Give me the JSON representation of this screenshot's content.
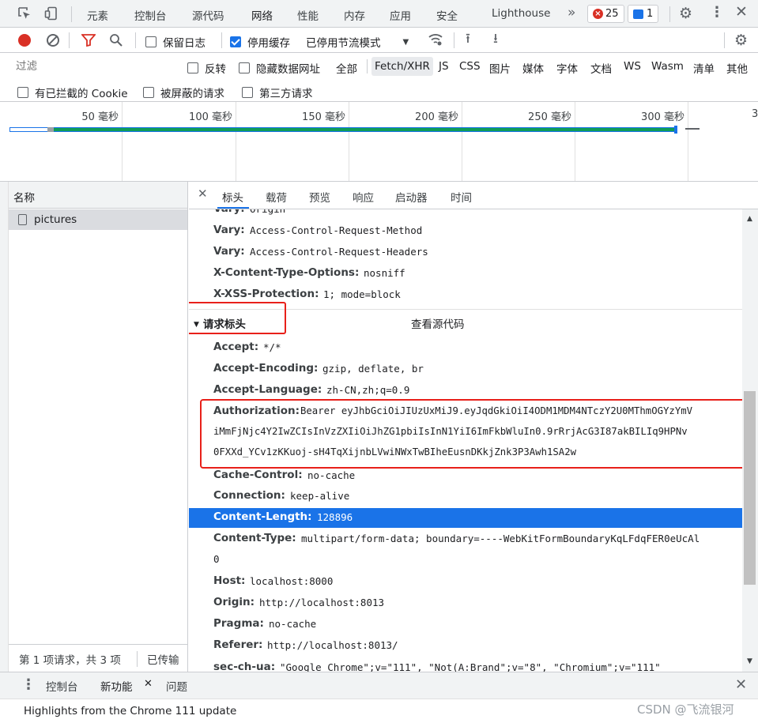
{
  "top_tabs": [
    "元素",
    "控制台",
    "源代码",
    "网络",
    "性能",
    "内存",
    "应用",
    "安全",
    "Lighthouse"
  ],
  "active_top_tab": "网络",
  "more_tabs": "»",
  "errors_count": "25",
  "messages_count": "1",
  "toolbar": {
    "preserve_log": "保留日志",
    "disable_cache": "停用缓存",
    "throttling": "已停用节流模式"
  },
  "filter": {
    "placeholder": "过滤",
    "invert": "反转",
    "hide_data_urls": "隐藏数据网址",
    "all": "全部",
    "types": [
      "Fetch/XHR",
      "JS",
      "CSS",
      "图片",
      "媒体",
      "字体",
      "文档",
      "WS",
      "Wasm",
      "清单",
      "其他"
    ]
  },
  "filter2": {
    "blocked_cookies": "有已拦截的 Cookie",
    "blocked_requests": "被屏蔽的请求",
    "third_party": "第三方请求"
  },
  "timeline_ticks": [
    "50 毫秒",
    "100 毫秒",
    "150 毫秒",
    "200 毫秒",
    "250 毫秒",
    "300 毫秒",
    "3"
  ],
  "left_panel": {
    "header": "名称",
    "item": "pictures",
    "status": "第 1 项请求，共 3 项",
    "transferred": "已传输"
  },
  "detail_tabs": [
    "标头",
    "载荷",
    "预览",
    "响应",
    "启动器",
    "时间"
  ],
  "response_headers": [
    {
      "k": "Vary:",
      "v": "Origin"
    },
    {
      "k": "Vary:",
      "v": "Access-Control-Request-Method"
    },
    {
      "k": "Vary:",
      "v": "Access-Control-Request-Headers"
    },
    {
      "k": "X-Content-Type-Options:",
      "v": "nosniff"
    },
    {
      "k": "X-XSS-Protection:",
      "v": "1; mode=block"
    }
  ],
  "request_section": {
    "title": "请求标头",
    "view_source": "查看源代码"
  },
  "request_headers": [
    {
      "k": "Accept:",
      "v": "*/*"
    },
    {
      "k": "Accept-Encoding:",
      "v": "gzip, deflate, br"
    },
    {
      "k": "Accept-Language:",
      "v": "zh-CN,zh;q=0.9"
    }
  ],
  "auth": {
    "k": "Authorization:",
    "l1": "Bearer eyJhbGciOiJIUzUxMiJ9.eyJqdGkiOiI4ODM1MDM4NTczY2U0MThmOGYzYmV",
    "l2": "iMmFjNjc4Y2IwZCIsInVzZXIiOiJhZG1pbiIsInN1YiI6ImFkbWluIn0.9rRrjAcG3I87akBILIq9HPNv",
    "l3": "0FXXd_YCv1zKKuoj-sH4TqXijnbLVwiNWxTwBIheEusnDKkjZnk3P3Awh1SA2w"
  },
  "request_headers2": [
    {
      "k": "Cache-Control:",
      "v": "no-cache"
    },
    {
      "k": "Connection:",
      "v": "keep-alive"
    },
    {
      "k": "Content-Length:",
      "v": "128896"
    },
    {
      "k": "Content-Type:",
      "v": "multipart/form-data; boundary=----WebKitFormBoundaryKqLFdqFER0eUcAl"
    },
    {
      "k": "",
      "v": "0"
    },
    {
      "k": "Host:",
      "v": "localhost:8000"
    },
    {
      "k": "Origin:",
      "v": "http://localhost:8013"
    },
    {
      "k": "Pragma:",
      "v": "no-cache"
    },
    {
      "k": "Referer:",
      "v": "http://localhost:8013/"
    },
    {
      "k": "sec-ch-ua:",
      "v": "\"Google Chrome\";v=\"111\", \"Not(A:Brand\";v=\"8\", \"Chromium\";v=\"111\""
    }
  ],
  "drawer": {
    "tabs": [
      "控制台",
      "新功能",
      "问题"
    ],
    "active": "新功能",
    "message": "Highlights from the Chrome 111 update"
  },
  "watermark": "CSDN @飞流银河",
  "colors": {
    "accent": "#1a73e8",
    "selected": "#1a73e8",
    "annotation": "#e8201a",
    "waterfall_green": "#0f9d58"
  }
}
